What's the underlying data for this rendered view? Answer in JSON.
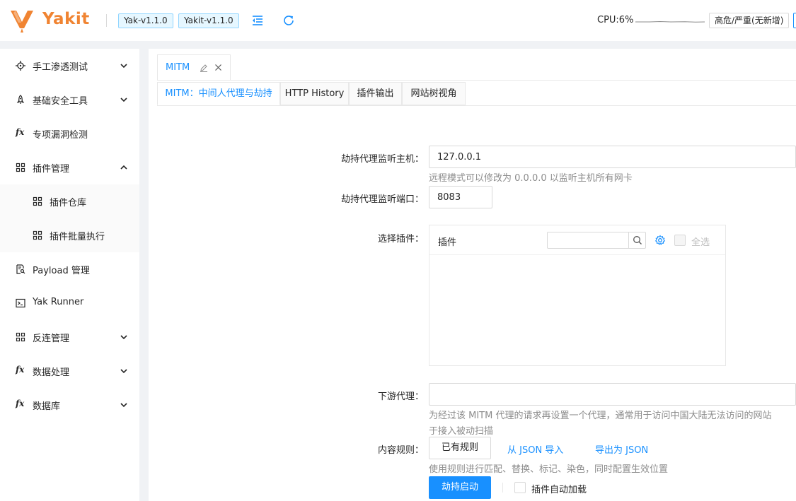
{
  "header": {
    "brand": "Yakit",
    "yak_version": "Yak-v1.1.0",
    "yakit_version": "Yakit-v1.1.0",
    "cpu": "CPU:6%",
    "risk_button": "高危/严重(无新增)"
  },
  "sidebar": {
    "items": [
      {
        "label": "手工渗透测试",
        "icon": "aim-icon",
        "expandable": true
      },
      {
        "label": "基础安全工具",
        "icon": "rocket-icon",
        "expandable": true
      },
      {
        "label": "专项漏洞检测",
        "icon": "fx-icon",
        "expandable": false
      },
      {
        "label": "插件管理",
        "icon": "appstore-icon",
        "expandable": true,
        "expanded": true,
        "children": [
          {
            "label": "插件仓库",
            "icon": "appstore-icon"
          },
          {
            "label": "插件批量执行",
            "icon": "appstore-icon"
          }
        ]
      },
      {
        "label": "Payload 管理",
        "icon": "file-search-icon",
        "expandable": false
      },
      {
        "label": "Yak Runner",
        "icon": "terminal-icon",
        "expandable": false
      },
      {
        "label": "反连管理",
        "icon": "appstore-icon",
        "expandable": true
      },
      {
        "label": "数据处理",
        "icon": "fx-icon",
        "expandable": true
      },
      {
        "label": "数据库",
        "icon": "fx-icon",
        "expandable": true
      }
    ]
  },
  "page_tab": {
    "label": "MITM"
  },
  "subtabs": [
    "MITM：中间人代理与劫持",
    "HTTP History",
    "插件输出",
    "网站树视角"
  ],
  "form": {
    "host_label": "劫持代理监听主机：",
    "host_value": "127.0.0.1",
    "host_help": "远程模式可以修改为 0.0.0.0 以监听主机所有网卡",
    "port_label": "劫持代理监听端口：",
    "port_value": "8083",
    "plugin_label": "选择插件：",
    "plugin_title": "插件",
    "plugin_search_placeholder": "",
    "select_all": "全选",
    "downstream_label": "下游代理：",
    "downstream_value": "",
    "downstream_help_1": "为经过该 MITM 代理的请求再设置一个代理，通常用于访问中国大陆无法访问的网站",
    "downstream_help_2": "于接入被动扫描",
    "rules_label": "内容规则：",
    "rules_button": "已有规则",
    "import_json": "从 JSON 导入",
    "export_json": "导出为 JSON",
    "rules_help": "使用规则进行匹配、替换、标记、染色，同时配置生效位置",
    "start_button": "劫持启动",
    "auto_load_label": "插件自动加载"
  },
  "colors": {
    "brand_orange": "#f08432",
    "primary": "#1890ff"
  }
}
